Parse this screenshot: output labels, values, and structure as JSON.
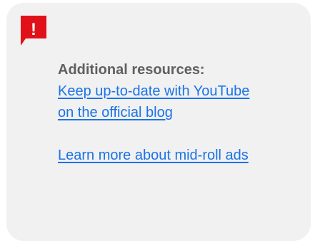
{
  "callout": {
    "icon": "alert-icon",
    "icon_symbol": "!",
    "icon_color": "#e1111a",
    "background_color": "#f1f1f1",
    "heading": "Additional resources:",
    "links": [
      {
        "label": "Keep up-to-date with YouTube on the official blog"
      },
      {
        "label": "Learn more about mid-roll ads"
      }
    ],
    "link_color": "#1a73e8"
  }
}
